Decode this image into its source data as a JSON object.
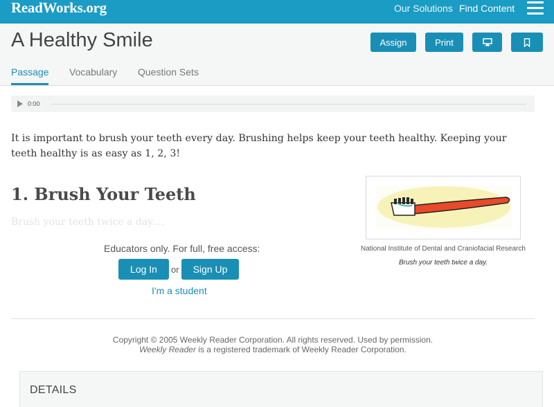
{
  "topbar": {
    "logo": "ReadWorks.org",
    "nav": [
      "Our Solutions",
      "Find Content"
    ],
    "color": "#1a9cc4"
  },
  "header": {
    "title": "A Healthy Smile",
    "buttons": {
      "assign": "Assign",
      "print": "Print"
    },
    "tabs": [
      "Passage",
      "Vocabulary",
      "Question Sets"
    ],
    "active_tab": "Passage",
    "accent": "#1a8fb6"
  },
  "audio": {
    "time": "0:00"
  },
  "passage": {
    "intro": "It is important to brush your teeth every day. Brushing helps keep your teeth healthy. Keeping your teeth healthy is as easy as 1, 2, 3!",
    "heading": "1. Brush Your Teeth",
    "faded_line": "Brush your teeth twice a day...."
  },
  "access": {
    "prompt": "Educators only. For full, free access:",
    "login": "Log In",
    "or": "or",
    "signup": "Sign Up",
    "student": "I'm a student"
  },
  "figure": {
    "source": "National Institute of Dental and Craniofacial Research",
    "caption": "Brush your teeth twice a day."
  },
  "copyright": {
    "line1": "Copyright © 2005 Weekly Reader Corporation. All rights reserved. Used by permission.",
    "line2_italic": "Weekly Reader",
    "line2_rest": " is a registered trademark of Weekly Reader Corporation."
  },
  "details": {
    "title": "DETAILS"
  }
}
